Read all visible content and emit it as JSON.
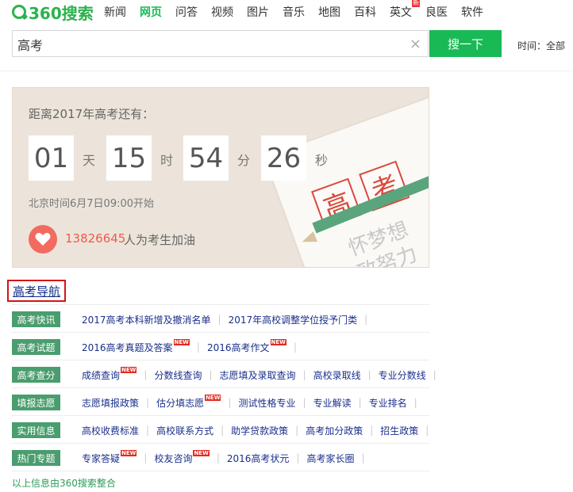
{
  "header": {
    "logo_text": "360搜索",
    "nav": [
      "新闻",
      "网页",
      "问答",
      "视频",
      "图片",
      "音乐",
      "地图",
      "百科",
      "英文",
      "良医",
      "软件"
    ],
    "active_nav": "网页",
    "new_badge": "新",
    "search_value": "高考",
    "clear_icon": "×",
    "search_button": "搜一下",
    "time_filter": "时间：全部"
  },
  "countdown": {
    "title": "距离2017年高考还有：",
    "days": "01",
    "day_unit": "天",
    "hours": "15",
    "hour_unit": "时",
    "minutes": "54",
    "minute_unit": "分",
    "seconds": "26",
    "second_unit": "秒",
    "beijing_time": "北京时间6月7日09:00开始",
    "cheer_count": "13826645",
    "cheer_text": "人为考生加油",
    "stamp_1": "高",
    "stamp_2": "考",
    "paper_faint_1": "怀梦想",
    "paper_faint_2": "致努力"
  },
  "nav_section": {
    "title": "高考导航",
    "new_tag": "NEW",
    "rows": [
      {
        "tag": "高考快讯",
        "links": [
          {
            "text": "2017高考本科新增及撤消名单"
          },
          {
            "text": "2017年高校调整学位授予门类"
          }
        ]
      },
      {
        "tag": "高考试题",
        "links": [
          {
            "text": "2016高考真题及答案",
            "new": true
          },
          {
            "text": "2016高考作文",
            "new": true
          }
        ]
      },
      {
        "tag": "高考查分",
        "links": [
          {
            "text": "成绩查询",
            "new": true
          },
          {
            "text": "分数线查询"
          },
          {
            "text": "志愿填及录取查询"
          },
          {
            "text": "高校录取线"
          },
          {
            "text": "专业分数线"
          }
        ]
      },
      {
        "tag": "填报志愿",
        "links": [
          {
            "text": "志愿填报政策"
          },
          {
            "text": "估分填志愿",
            "new": true
          },
          {
            "text": "测试性格专业"
          },
          {
            "text": "专业解读"
          },
          {
            "text": "专业排名"
          }
        ]
      },
      {
        "tag": "实用信息",
        "links": [
          {
            "text": "高校收费标准"
          },
          {
            "text": "高校联系方式"
          },
          {
            "text": "助学贷款政策"
          },
          {
            "text": "高考加分政策"
          },
          {
            "text": "招生政策"
          }
        ]
      },
      {
        "tag": "热门专题",
        "links": [
          {
            "text": "专家答疑",
            "new": true
          },
          {
            "text": "校友咨询",
            "new": true
          },
          {
            "text": "2016高考状元"
          },
          {
            "text": "高考家长圈"
          }
        ]
      }
    ],
    "footer": "以上信息由360搜索整合"
  },
  "colors": {
    "brand_green": "#19b955",
    "tag_green": "#4a9d6e",
    "link_blue": "#1a2f8b",
    "accent_red": "#f05a4b"
  }
}
